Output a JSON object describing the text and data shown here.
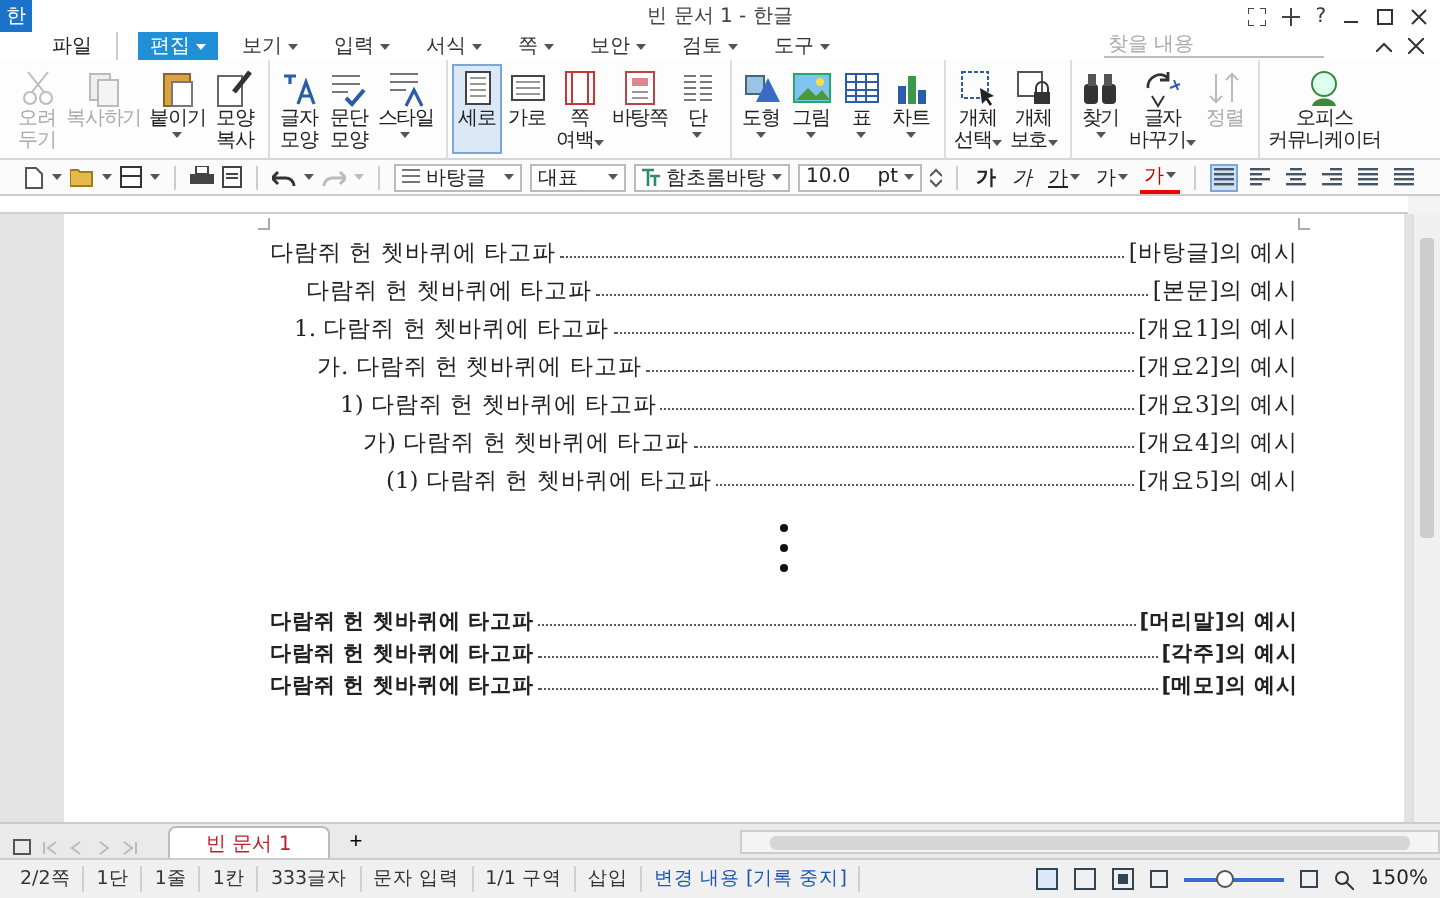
{
  "window": {
    "logo": "한",
    "title": "빈 문서 1 - 한글",
    "help": "?"
  },
  "menu": {
    "file": "파일",
    "tabs": [
      {
        "label": "편집",
        "selected": true
      },
      {
        "label": "보기",
        "selected": false
      },
      {
        "label": "입력",
        "selected": false
      },
      {
        "label": "서식",
        "selected": false
      },
      {
        "label": "쪽",
        "selected": false
      },
      {
        "label": "보안",
        "selected": false
      },
      {
        "label": "검토",
        "selected": false
      },
      {
        "label": "도구",
        "selected": false
      }
    ],
    "search": {
      "placeholder": "찾을 내용"
    }
  },
  "ribbon": [
    [
      {
        "kind": "scissors",
        "lines": [
          "오려",
          "두기"
        ],
        "disabled": true,
        "selected": false,
        "dropdown": false
      },
      {
        "kind": "copy",
        "lines": [
          "복사하기"
        ],
        "disabled": true,
        "selected": false,
        "dropdown": false
      },
      {
        "kind": "paste",
        "lines": [
          "붙이기"
        ],
        "disabled": false,
        "selected": false,
        "dropdown": true
      },
      {
        "kind": "painter",
        "lines": [
          "모양",
          "복사"
        ],
        "disabled": false,
        "selected": false,
        "dropdown": false
      }
    ],
    [
      {
        "kind": "charshape",
        "lines": [
          "글자",
          "모양"
        ],
        "disabled": false,
        "selected": false,
        "dropdown": false
      },
      {
        "kind": "parashape",
        "lines": [
          "문단",
          "모양"
        ],
        "disabled": false,
        "selected": false,
        "dropdown": false
      },
      {
        "kind": "style",
        "lines": [
          "스타일"
        ],
        "disabled": false,
        "selected": false,
        "dropdown": true
      }
    ],
    [
      {
        "kind": "portrait",
        "lines": [
          "세로"
        ],
        "disabled": false,
        "selected": true,
        "dropdown": false
      },
      {
        "kind": "landscape",
        "lines": [
          "가로"
        ],
        "disabled": false,
        "selected": false,
        "dropdown": false
      },
      {
        "kind": "margin",
        "lines": [
          "쪽",
          "여백"
        ],
        "disabled": false,
        "selected": false,
        "dropdown": true
      },
      {
        "kind": "masterpage",
        "lines": [
          "바탕쪽"
        ],
        "disabled": false,
        "selected": false,
        "dropdown": false
      },
      {
        "kind": "columns",
        "lines": [
          "단"
        ],
        "disabled": false,
        "selected": false,
        "dropdown": true
      }
    ],
    [
      {
        "kind": "shape",
        "lines": [
          "도형"
        ],
        "disabled": false,
        "selected": false,
        "dropdown": true
      },
      {
        "kind": "picture",
        "lines": [
          "그림"
        ],
        "disabled": false,
        "selected": false,
        "dropdown": true
      },
      {
        "kind": "table",
        "lines": [
          "표"
        ],
        "disabled": false,
        "selected": false,
        "dropdown": true
      },
      {
        "kind": "chart",
        "lines": [
          "차트"
        ],
        "disabled": false,
        "selected": false,
        "dropdown": true
      }
    ],
    [
      {
        "kind": "select",
        "lines": [
          "개체",
          "선택"
        ],
        "disabled": false,
        "selected": false,
        "dropdown": true
      },
      {
        "kind": "protect",
        "lines": [
          "개체",
          "보호"
        ],
        "disabled": false,
        "selected": false,
        "dropdown": true
      }
    ],
    [
      {
        "kind": "find",
        "lines": [
          "찾기"
        ],
        "disabled": false,
        "selected": false,
        "dropdown": true
      },
      {
        "kind": "replace",
        "lines": [
          "글자",
          "바꾸기"
        ],
        "disabled": false,
        "selected": false,
        "dropdown": true
      },
      {
        "kind": "sort",
        "lines": [
          "정렬"
        ],
        "disabled": true,
        "selected": false,
        "dropdown": false
      }
    ],
    [
      {
        "kind": "messenger",
        "lines": [
          "오피스",
          "커뮤니케이터"
        ],
        "disabled": false,
        "selected": false,
        "dropdown": false
      }
    ]
  ],
  "format_bar": {
    "style": "바탕글",
    "language": "대표",
    "font": "함초롬바탕",
    "size": "10.0",
    "unit": "pt",
    "char_buttons": [
      {
        "label": "가",
        "kind": "bold"
      },
      {
        "label": "가",
        "kind": "italic"
      },
      {
        "label": "가",
        "kind": "underline"
      },
      {
        "label": "가",
        "kind": "plain"
      },
      {
        "label": "가",
        "kind": "color"
      }
    ],
    "align": [
      {
        "kind": "justify",
        "selected": true
      },
      {
        "kind": "left",
        "selected": false
      },
      {
        "kind": "center",
        "selected": false
      },
      {
        "kind": "right",
        "selected": false
      },
      {
        "kind": "distribute",
        "selected": false
      },
      {
        "kind": "divide",
        "selected": false
      }
    ]
  },
  "document": {
    "paragraphs": [
      {
        "kind": "plain",
        "text": "다람쥐 헌 쳇바퀴에 타고파",
        "ref": "[바탕글]의 예시"
      },
      {
        "kind": "body",
        "text": "다람쥐 헌 쳇바퀴에 타고파",
        "ref": "[본문]의 예시"
      },
      {
        "kind": "outline",
        "text": "1. 다람쥐 헌 쳇바퀴에 타고파",
        "ref": "[개요1]의 예시",
        "children": [
          {
            "kind": "outline",
            "text": "가. 다람쥐 헌 쳇바퀴에 타고파",
            "ref": "[개요2]의 예시",
            "children": [
              {
                "kind": "outline",
                "text": "1) 다람쥐 헌 쳇바퀴에 타고파",
                "ref": "[개요3]의 예시",
                "children": [
                  {
                    "kind": "outline",
                    "text": "가) 다람쥐 헌 쳇바퀴에 타고파",
                    "ref": "[개요4]의 예시",
                    "children": [
                      {
                        "kind": "outline",
                        "text": "(1) 다람쥐 헌 쳇바퀴에 타고파",
                        "ref": "[개요5]의 예시"
                      }
                    ]
                  }
                ]
              }
            ]
          }
        ]
      }
    ],
    "notes": [
      {
        "text": "다람쥐 헌 쳇바퀴에 타고파",
        "ref": "[머리말]의 예시"
      },
      {
        "text": "다람쥐 헌 쳇바퀴에 타고파",
        "ref": "[각주]의 예시"
      },
      {
        "text": "다람쥐 헌 쳇바퀴에 타고파",
        "ref": "[메모]의 예시"
      }
    ]
  },
  "doc_tabs": [
    {
      "label": "빈 문서 1",
      "selected": true
    }
  ],
  "new_tab": "+",
  "status_bar": {
    "items": [
      "2/2쪽",
      "1단",
      "1줄",
      "1칸",
      "333글자",
      "문자 입력",
      "1/1 구역",
      "삽입"
    ],
    "track_changes": "변경 내용 [기록 중지]",
    "zoom": {
      "level": 0.4,
      "reading": "150%"
    }
  }
}
